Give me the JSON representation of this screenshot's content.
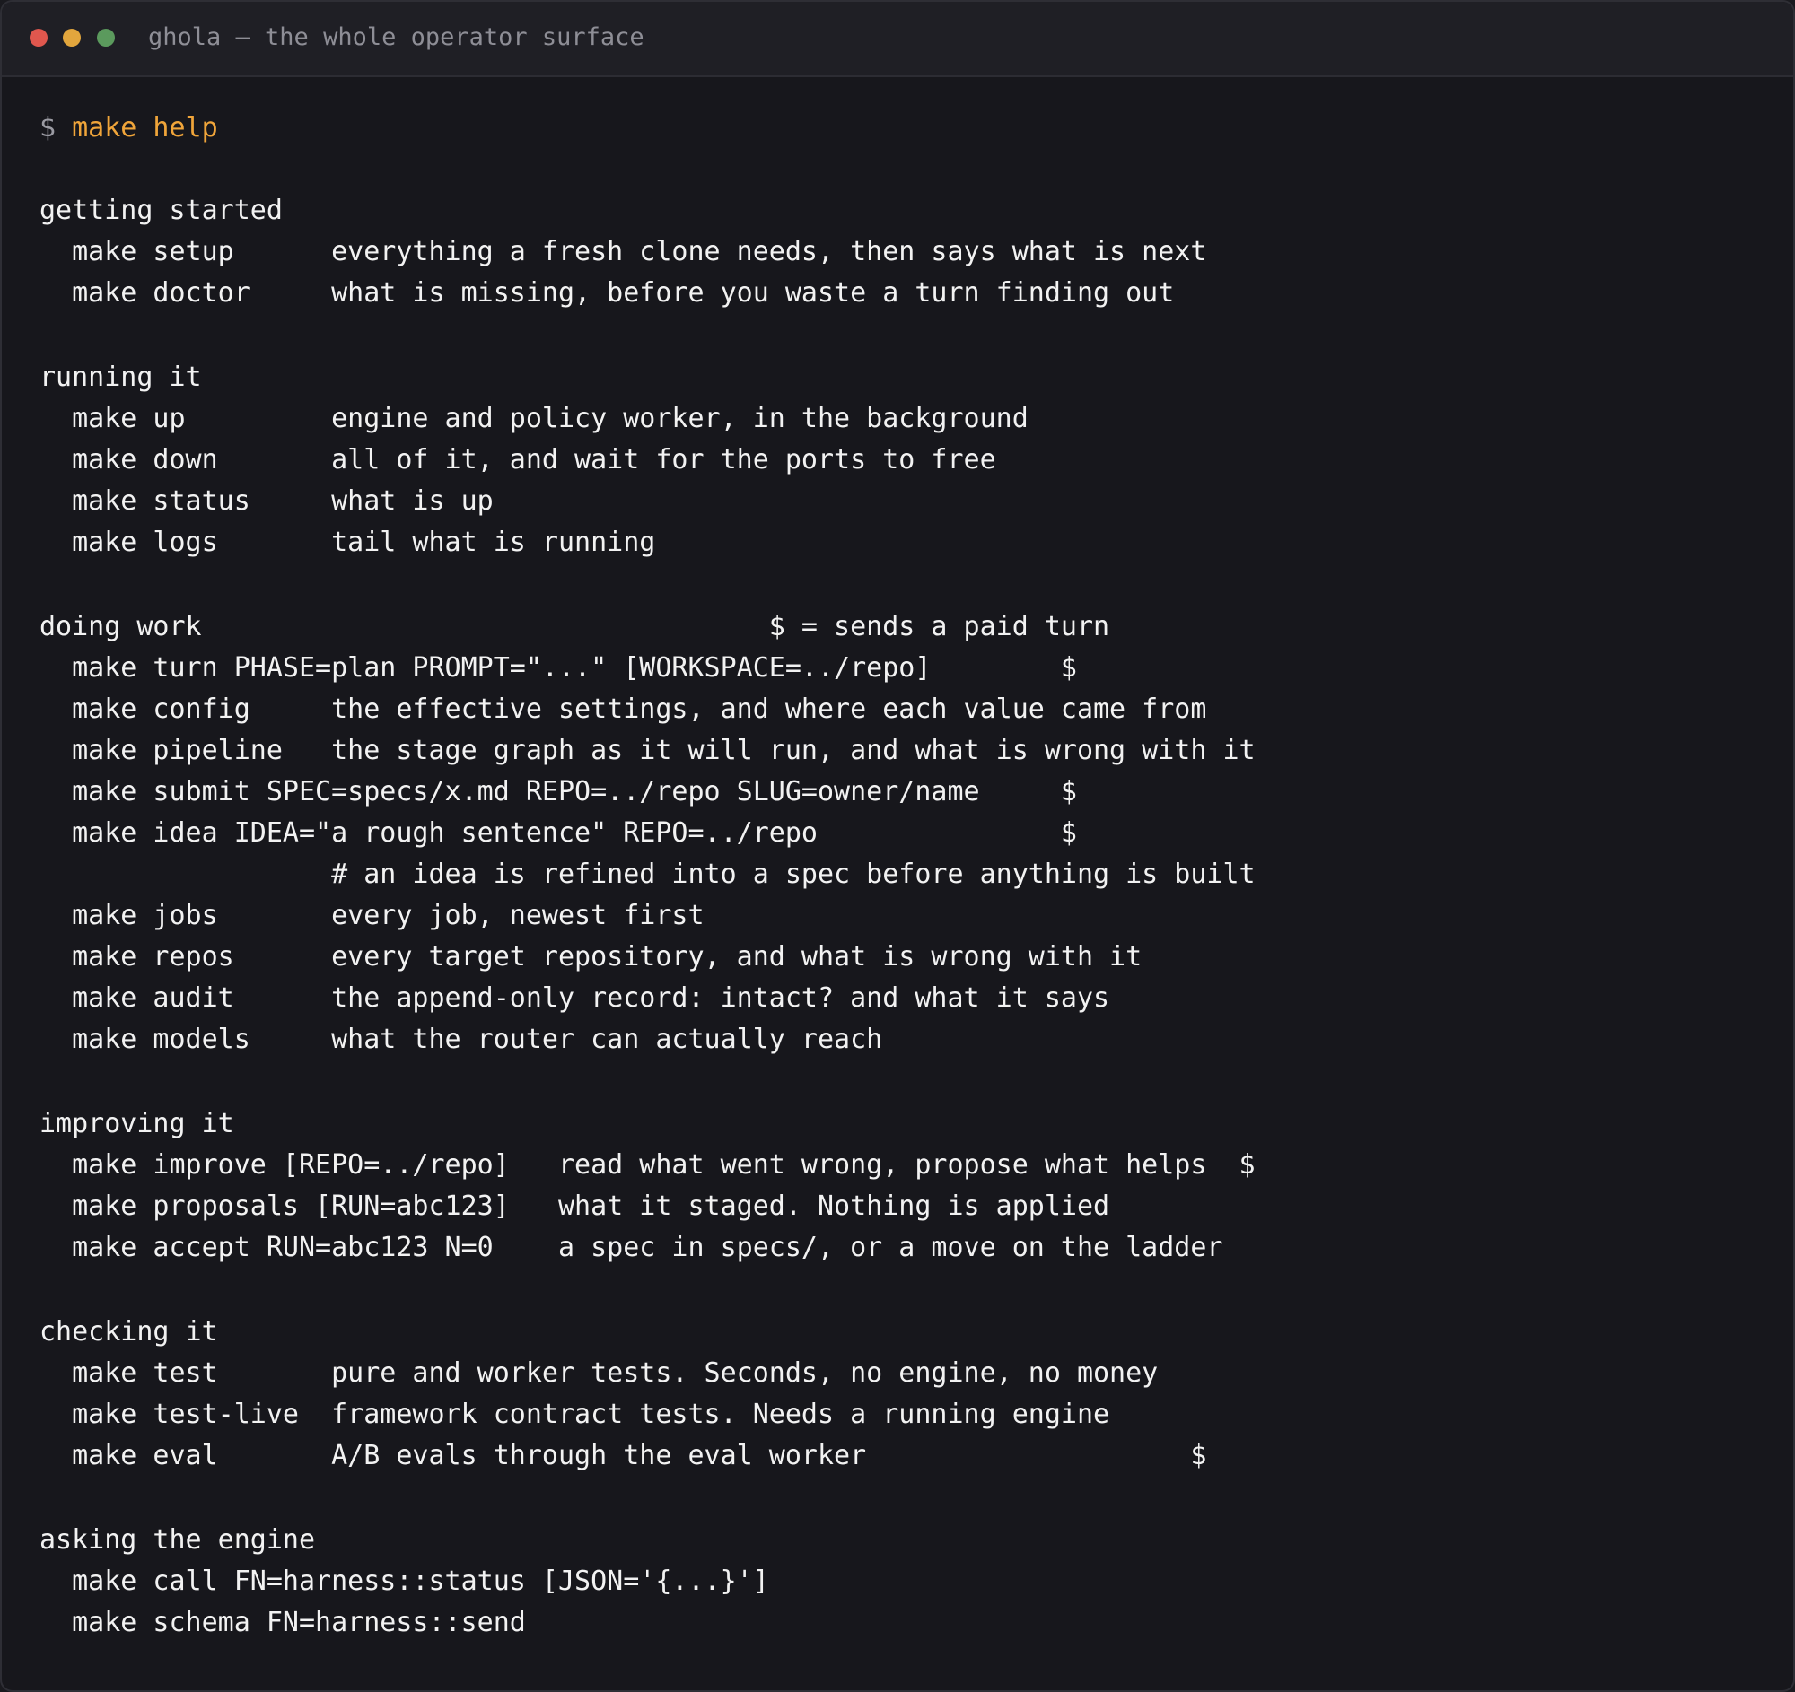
{
  "window": {
    "title": "ghola — the whole operator surface"
  },
  "terminal": {
    "prompt_symbol": "$ ",
    "prompt_command": "make help",
    "lines": [
      "getting started",
      "  make setup      everything a fresh clone needs, then says what is next",
      "  make doctor     what is missing, before you waste a turn finding out",
      "running it",
      "  make up         engine and policy worker, in the background",
      "  make down       all of it, and wait for the ports to free",
      "  make status     what is up",
      "  make logs       tail what is running",
      "doing work                                   $ = sends a paid turn",
      "  make turn PHASE=plan PROMPT=\"...\" [WORKSPACE=../repo]        $",
      "  make config     the effective settings, and where each value came from",
      "  make pipeline   the stage graph as it will run, and what is wrong with it",
      "  make submit SPEC=specs/x.md REPO=../repo SLUG=owner/name     $",
      "  make idea IDEA=\"a rough sentence\" REPO=../repo               $",
      "                  # an idea is refined into a spec before anything is built",
      "  make jobs       every job, newest first",
      "  make repos      every target repository, and what is wrong with it",
      "  make audit      the append-only record: intact? and what it says",
      "  make models     what the router can actually reach",
      "improving it",
      "  make improve [REPO=../repo]   read what went wrong, propose what helps  $",
      "  make proposals [RUN=abc123]   what it staged. Nothing is applied",
      "  make accept RUN=abc123 N=0    a spec in specs/, or a move on the ladder",
      "checking it",
      "  make test       pure and worker tests. Seconds, no engine, no money",
      "  make test-live  framework contract tests. Needs a running engine",
      "  make eval       A/B evals through the eval worker                    $",
      "asking the engine",
      "  make call FN=harness::status [JSON='{...}']",
      "  make schema FN=harness::send"
    ]
  }
}
